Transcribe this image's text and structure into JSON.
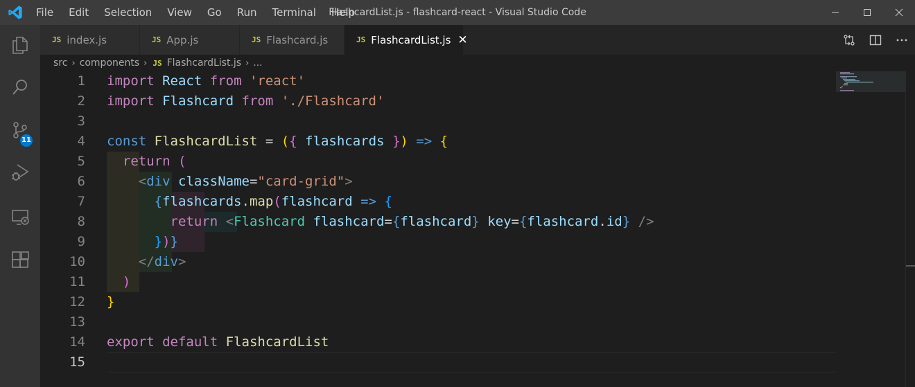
{
  "window": {
    "title": "FlashcardList.js - flashcard-react - Visual Studio Code",
    "menu": [
      "File",
      "Edit",
      "Selection",
      "View",
      "Go",
      "Run",
      "Terminal",
      "Help"
    ]
  },
  "activity_bar": {
    "items": [
      {
        "name": "explorer-icon"
      },
      {
        "name": "search-icon"
      },
      {
        "name": "source-control-icon",
        "badge": "11"
      },
      {
        "name": "run-debug-icon"
      },
      {
        "name": "remote-explorer-icon"
      },
      {
        "name": "extensions-icon"
      }
    ]
  },
  "tabs": [
    {
      "icon": "JS",
      "label": "index.js",
      "active": false
    },
    {
      "icon": "JS",
      "label": "App.js",
      "active": false
    },
    {
      "icon": "JS",
      "label": "Flashcard.js",
      "active": false
    },
    {
      "icon": "JS",
      "label": "FlashcardList.js",
      "active": true,
      "close": "✕"
    }
  ],
  "breadcrumbs": {
    "items": [
      "src",
      "components",
      "FlashcardList.js",
      "..."
    ],
    "file_icon": "JS"
  },
  "editor": {
    "current_line": 15,
    "lines": [
      "1",
      "2",
      "3",
      "4",
      "5",
      "6",
      "7",
      "8",
      "9",
      "10",
      "11",
      "12",
      "13",
      "14",
      "15"
    ]
  },
  "colors": {
    "accent": "#007acc",
    "js_icon": "#cbcb41",
    "editor_bg": "#1e1e1e",
    "titlebar_bg": "#3c3c3c"
  }
}
